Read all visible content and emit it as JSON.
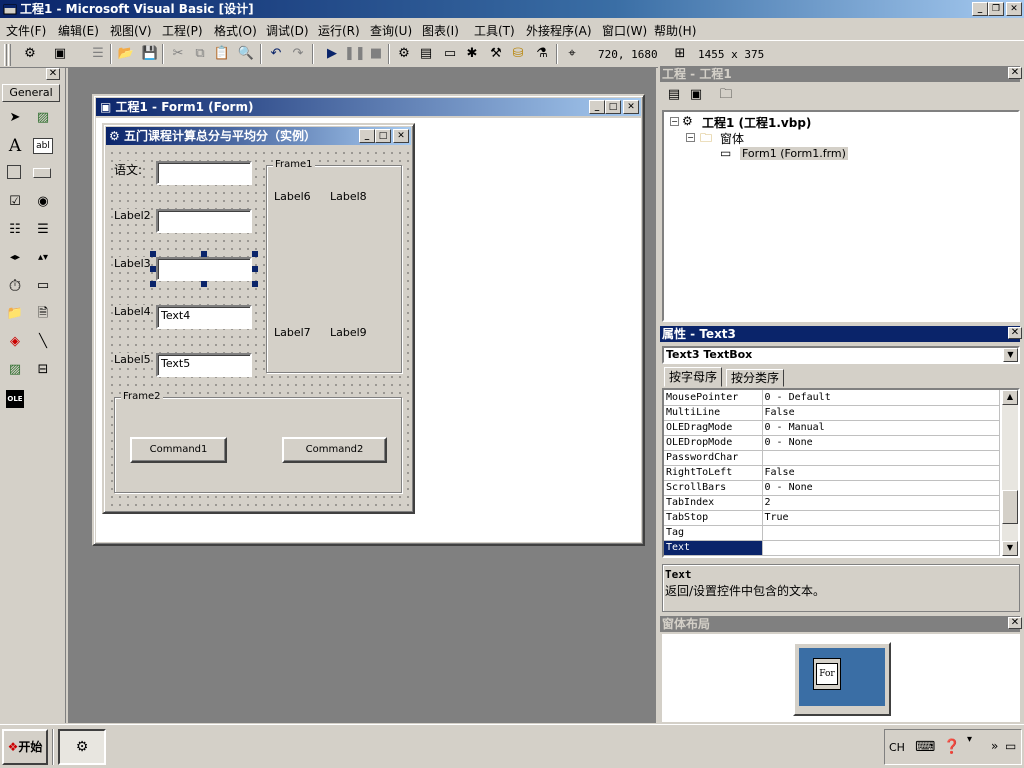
{
  "titlebar": {
    "title": "工程1 - Microsoft Visual Basic [设计]",
    "minimize": "_",
    "restore": "❐",
    "close": "✕"
  },
  "menu": [
    "文件(F)",
    "编辑(E)",
    "视图(V)",
    "工程(P)",
    "格式(O)",
    "调试(D)",
    "运行(R)",
    "查询(U)",
    "图表(I)",
    "工具(T)",
    "外接程序(A)",
    "窗口(W)",
    "帮助(H)"
  ],
  "toolbar": {
    "position": "720, 1680",
    "size": "1455 x 375"
  },
  "toolbox": {
    "tab_label": "General",
    "close": "✕"
  },
  "form_window": {
    "title": "工程1 - Form1 (Form)",
    "design_form": {
      "caption": "五门课程计算总分与平均分（实例）",
      "label1": "语文:",
      "label2": "Label2",
      "label3": "Label3",
      "label4": "Label4",
      "label5": "Label5",
      "text1": "",
      "text2": "",
      "text3": "",
      "text4": "Text4",
      "text5": "Text5",
      "frame1": "Frame1",
      "label6": "Label6",
      "label7": "Label7",
      "label8": "Label8",
      "label9": "Label9",
      "frame2": "Frame2",
      "command1": "Command1",
      "command2": "Command2"
    }
  },
  "project_panel": {
    "title": "工程 - 工程1",
    "root": "工程1 (工程1.vbp)",
    "folder": "窗体",
    "item": "Form1 (Form1.frm)"
  },
  "properties_panel": {
    "title": "属性 - Text3",
    "object_select": "Text3 TextBox",
    "tab_alpha": "按字母序",
    "tab_category": "按分类序",
    "rows": [
      {
        "name": "MousePointer",
        "value": "0 - Default"
      },
      {
        "name": "MultiLine",
        "value": "False"
      },
      {
        "name": "OLEDragMode",
        "value": "0 - Manual"
      },
      {
        "name": "OLEDropMode",
        "value": "0 - None"
      },
      {
        "name": "PasswordChar",
        "value": ""
      },
      {
        "name": "RightToLeft",
        "value": "False"
      },
      {
        "name": "ScrollBars",
        "value": "0 - None"
      },
      {
        "name": "TabIndex",
        "value": "2"
      },
      {
        "name": "TabStop",
        "value": "True"
      },
      {
        "name": "Tag",
        "value": ""
      },
      {
        "name": "Text",
        "value": ""
      }
    ],
    "desc_title": "Text",
    "desc_text": "返回/设置控件中包含的文本。"
  },
  "layout_panel": {
    "title": "窗体布局",
    "form_label": "For"
  },
  "taskbar": {
    "start": "开始",
    "tray_lang": "CH"
  }
}
